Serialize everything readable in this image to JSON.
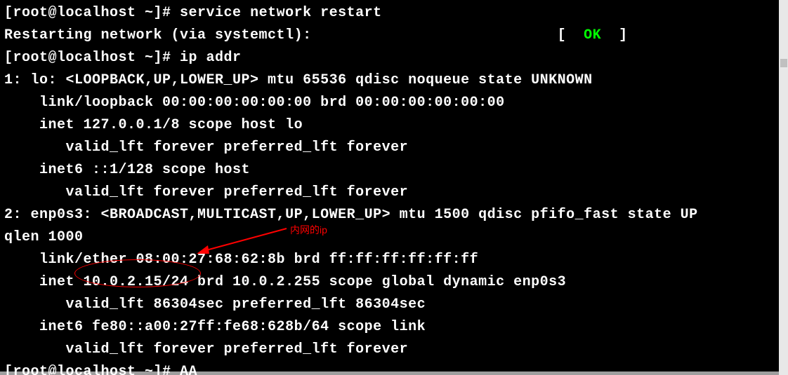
{
  "terminal": {
    "l1_prompt": "[root@localhost ~]# ",
    "l1_cmd": "service network restart",
    "l2a": "Restarting network (via systemctl):",
    "l2b_spaces": "                            ",
    "l2b_lb": "[  ",
    "l2b_ok": "OK",
    "l2b_rb": "  ]",
    "l3_prompt": "[root@localhost ~]# ",
    "l3_cmd": "ip addr",
    "l4": "1: lo: <LOOPBACK,UP,LOWER_UP> mtu 65536 qdisc noqueue state UNKNOWN",
    "l5": "    link/loopback 00:00:00:00:00:00 brd 00:00:00:00:00:00",
    "l6": "    inet 127.0.0.1/8 scope host lo",
    "l7": "       valid_lft forever preferred_lft forever",
    "l8": "    inet6 ::1/128 scope host",
    "l9": "       valid_lft forever preferred_lft forever",
    "l10": "2: enp0s3: <BROADCAST,MULTICAST,UP,LOWER_UP> mtu 1500 qdisc pfifo_fast state UP ",
    "l11": "qlen 1000",
    "l12": "    link/ether 08:00:27:68:62:8b brd ff:ff:ff:ff:ff:ff",
    "l13": "    inet 10.0.2.15/24 brd 10.0.2.255 scope global dynamic enp0s3",
    "l14": "       valid_lft 86304sec preferred_lft 86304sec",
    "l15": "    inet6 fe80::a00:27ff:fe68:628b/64 scope link",
    "l16": "       valid_lft forever preferred_lft forever",
    "l17_prompt": "[root@localhost ~]# ",
    "l17_input": "AA"
  },
  "annotation": {
    "label": "内网的ip"
  }
}
